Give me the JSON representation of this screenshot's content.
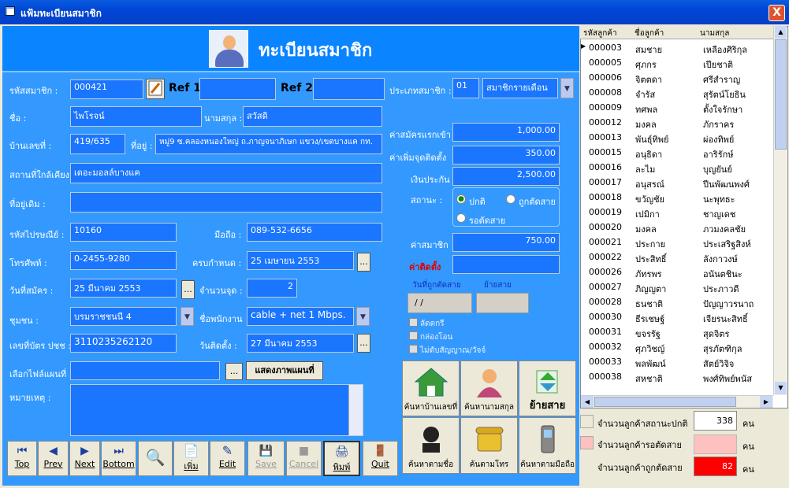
{
  "window": {
    "title": "แฟ้มทะเบียนสมาชิก",
    "close": "X"
  },
  "header": {
    "title": "ทะเบียนสมาชิก"
  },
  "labels": {
    "member_code": "รหัสสมาชิก :",
    "ref1": "Ref 1",
    "ref2": "Ref 2",
    "member_type": "ประเภทสมาชิก :",
    "name": "ชื่อ :",
    "surname": "นามสกุล :",
    "house_no": "บ้านเลขที่ :",
    "address": "ที่อยู่ :",
    "nearby": "สถานที่ใกล้เคียง",
    "old_address": "ที่อยู่เดิม :",
    "postcode": "รหัสไปรษณีย์ :",
    "mobile": "มือถือ :",
    "phone": "โทรศัพท์ :",
    "due": "ครบกำหนด :",
    "apply_date": "วันที่สมัคร :",
    "points": "จำนวนจุด :",
    "community": "ชุมชน :",
    "employee": "ชื่อพนักงาน",
    "id_card": "เลขที่บัตร ปชช :",
    "install_date": "วันติดตั้ง :",
    "map_file": "เลือกไฟล์แผนที่",
    "notes": "หมายเหตุ :",
    "fee_apply": "ค่าสมัครแรกเข้า",
    "fee_extra": "ค่าเพิ่มจุดติดตั้ง",
    "deposit": "เงินประกัน",
    "status": "สถานะ :",
    "fee_member": "ค่าสมาชิก",
    "fee_install": "ค่าติดตั้ง",
    "cut_date": "วันที่ถูกตัดสาย",
    "moved": "ย้ายสาย"
  },
  "fields": {
    "member_code": "000421",
    "ref1": "",
    "ref2": "",
    "member_type_code": "01",
    "member_type": "สมาชิกรายเดือน",
    "name": "ไพโรจน์",
    "surname": "สวัสดิ",
    "house_no": "419/635",
    "address": "หมู่9 ซ.คลองหนองใหญ่ ถ.ภาญจนาภิเษก แขวง/เขตบางแค กท.",
    "nearby": "เดอะมอลล์บางแค",
    "old_address": "",
    "postcode": "10160",
    "mobile": "089-532-6656",
    "phone": "0-2455-9280",
    "due": "25 เมษายน 2553",
    "apply_date": "25 มีนาคม 2553",
    "points": "2",
    "community": "บรมราชชนนี 4",
    "employee": "cable + net 1 Mbps.",
    "id_card": "3110235262120",
    "install_date": "27 มีนาคม 2553",
    "map_file": "",
    "notes": "",
    "fee_apply": "1,000.00",
    "fee_extra": "350.00",
    "deposit": "2,500.00",
    "fee_member": "750.00",
    "fee_install": "",
    "cut_date": " / /",
    "moved": ""
  },
  "status_options": [
    {
      "label": "ปกติ",
      "checked": true
    },
    {
      "label": "ถูกตัดสาย",
      "checked": false
    },
    {
      "label": "รอตัดสาย",
      "checked": false
    }
  ],
  "checkboxes": [
    "ลัดตกรี",
    "กล่องโอน",
    "ไม่ดับสัญญาณ/วัจจ์"
  ],
  "buttons": {
    "show_map": "แสดงภาพแผนที่",
    "browse": "...",
    "top": "Top",
    "prev": "Prev",
    "next": "Next",
    "bottom": "Bottom",
    "add": "เพิ่ม",
    "edit": "Edit",
    "save": "Save",
    "cancel": "Cancel",
    "print": "พิมพ์",
    "quit": "Quit"
  },
  "tiles": {
    "search_house": "ค้นหาบ้านเลขที่",
    "search_surname": "ค้นหานามสกุล",
    "move_line": "ย้ายสาย",
    "search_name": "ค้นหาตามชื่อ",
    "search_phone": "ค้นตามโทร",
    "search_mobile": "ค้นหาตามมือถือ"
  },
  "list": {
    "headers": [
      "รหัสลูกค้า",
      "ชื่อลูกค้า",
      "นามสกุล"
    ],
    "rows": [
      [
        "000003",
        "สมชาย",
        "เหลืองศิริกุล"
      ],
      [
        "000005",
        "ศุภกร",
        "เปียชาติ"
      ],
      [
        "000006",
        "จิตตดา",
        "ศรีสำราญ"
      ],
      [
        "000008",
        "จำรัส",
        "สุรัตน์โยธิน"
      ],
      [
        "000009",
        "ทศพล",
        "ตั้งใจรักษา"
      ],
      [
        "000012",
        "มงคล",
        "ภักราคร"
      ],
      [
        "000013",
        "พันธุ์ทิพย์",
        "ผ่องทิพย์"
      ],
      [
        "000015",
        "อนุธิดา",
        "อาริรักษ์"
      ],
      [
        "000016",
        "ละไม",
        "บุญยันย์"
      ],
      [
        "000017",
        "อนุสรณ์",
        "ปีนพัฒนพงศ์"
      ],
      [
        "000018",
        "ขวัญชัย",
        "นะพุทธะ"
      ],
      [
        "000019",
        "เปมิกา",
        "ชาญเดช"
      ],
      [
        "000020",
        "มงคล",
        "ภวมงคลชัย"
      ],
      [
        "000021",
        "ประกาย",
        "ประเสริฐสิงห์"
      ],
      [
        "000022",
        "ประสิทธิ์",
        "ลังกาวงษ์"
      ],
      [
        "000026",
        "ภัทรพร",
        "อนันตชินะ"
      ],
      [
        "000027",
        "ภิญญตา",
        "ประภาวดี"
      ],
      [
        "000028",
        "ธนชาติ",
        "ปัญญาวรนาถ"
      ],
      [
        "000030",
        "ธีรเชษฐ์",
        "เจียรนะสิทธิ์"
      ],
      [
        "000031",
        "ขจรรัฐ",
        "สุดจิตร"
      ],
      [
        "000032",
        "ศุภวิชญ์",
        "สุรภัตฑิกุล"
      ],
      [
        "000033",
        "พลพัฒน์",
        "สัตย์วิจิจ"
      ],
      [
        "000038",
        "สหชาติ",
        "พงศ์ทิพย์พนัส"
      ]
    ]
  },
  "summary": {
    "normal_label": "จำนวนลูกค้าสถานะปกติ",
    "normal_count": "338",
    "pending_label": "จำนวนลูกค้ารอตัดสาย",
    "pending_count": "",
    "cut_label": "จำนวนลูกค้าถูกตัดสาย",
    "cut_count": "82",
    "unit": "คน"
  },
  "colors": {
    "form_bg": "#3399ff",
    "field_bg": "#1a75ff",
    "title_bar": "#0046d5",
    "alert_red": "#ff0000",
    "pending_pink": "#ffc0c0"
  }
}
